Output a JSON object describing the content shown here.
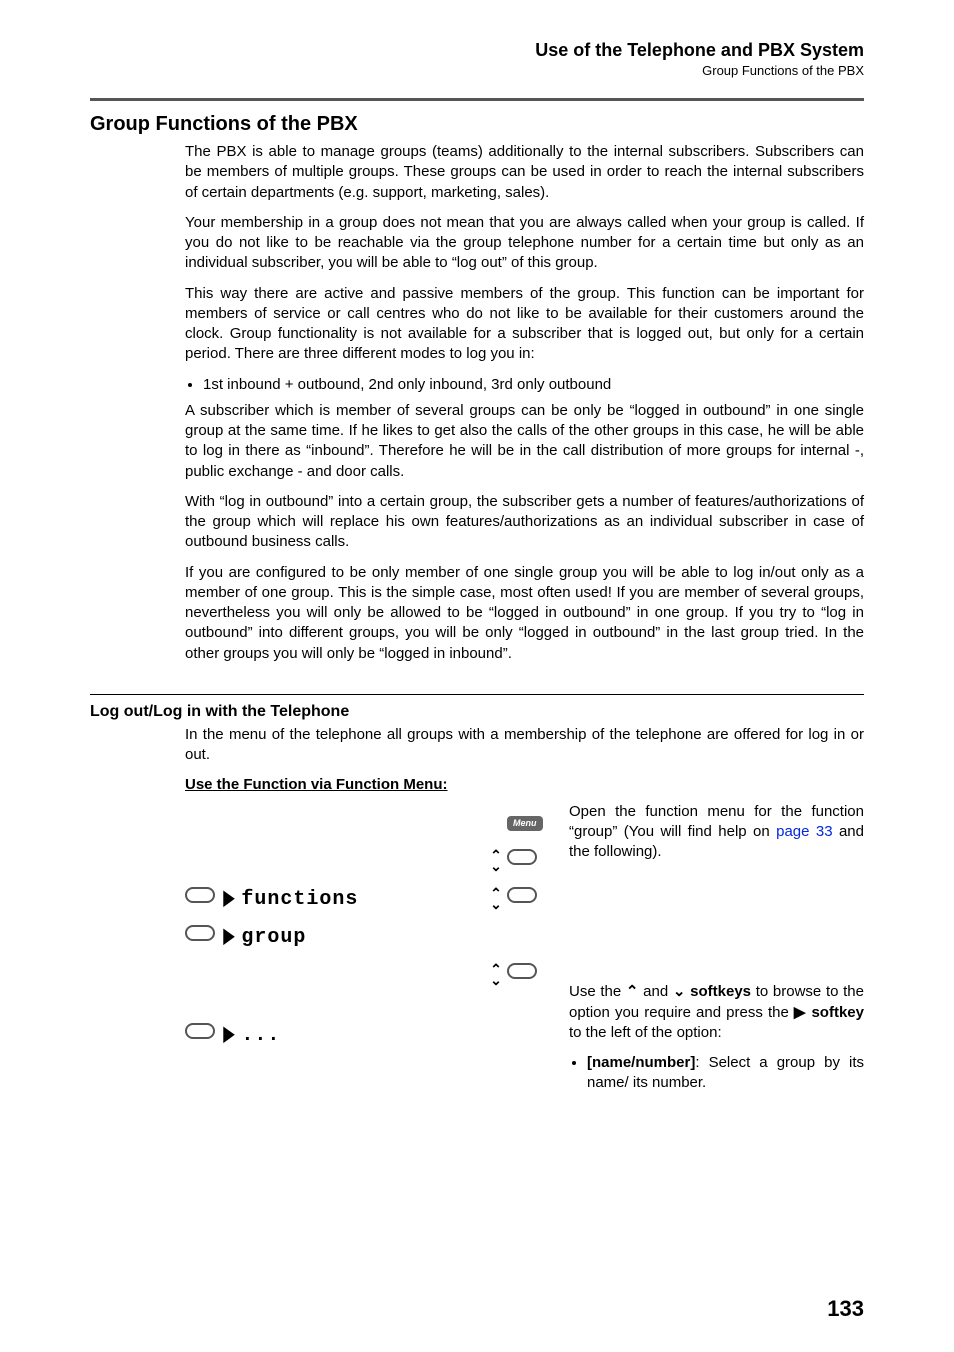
{
  "header": {
    "title": "Use of the Telephone and PBX System",
    "subtitle": "Group Functions of the PBX"
  },
  "section": {
    "heading": "Group Functions of the PBX",
    "paragraphs": [
      "The PBX is able to manage groups (teams) additionally to the internal subscribers. Subscribers can be members of multiple groups. These groups can be used in order to reach the internal subscribers of certain departments (e.g. support, marketing, sales).",
      "Your membership in a group does not mean that you are always called when your group is called. If you do not like to be reachable via the group telephone number for a certain time but only as an individual subscriber, you will be able to “log out” of this group.",
      "This way there are active and passive members of the group. This function can be important for members of service or call centres who do not like to be available for their customers around the clock. Group functionality is not available for a subscriber that is logged out, but only for a certain period. There are three different modes to log you in:"
    ],
    "bullet1": "1st inbound + outbound, 2nd only inbound, 3rd only outbound",
    "paragraphs2": [
      "A subscriber which is member of several groups can be only be “logged in outbound” in one single group at the same time. If he likes to get also the calls of the other groups in this case, he will be able to log in there as “inbound”. Therefore he will be in the call distribution of more groups for internal -, public exchange - and door calls.",
      "With “log in outbound” into a certain group, the subscriber gets a number of features/authorizations of the group which will replace his own features/authorizations as an individual subscriber in case of outbound business calls.",
      "If you are configured to be only member of one single group you will be able to log in/out only as a member of one group. This is the simple case, most often used! If you are member of several groups, nevertheless you will only be allowed to be “logged in outbound” in one group. If you try to “log in outbound” into different groups, you will be only “logged in outbound” in the last group tried. In the other groups you will only be “logged in inbound”."
    ]
  },
  "subsection": {
    "heading": "Log out/Log in with the Telephone",
    "intro": "In the menu of the telephone all groups with a membership of the telephone are offered for log in or out.",
    "func_heading": "Use the Function via Function Menu:"
  },
  "lcd": {
    "menu_label": "Menu",
    "row_functions": "functions",
    "row_group": "group",
    "row_dots": "..."
  },
  "rightcol": {
    "p1_a": "Open the function menu for the function “group” (You will find help on ",
    "p1_link": "page 33",
    "p1_b": " and the following).",
    "p2_a": "Use the ",
    "p2_b": " and ",
    "p2_c": " softkeys",
    "p2_d": " to browse to the option you require and press the ",
    "p2_e": " softkey",
    "p2_f": " to the left of the option:",
    "li_a": "[name/number]",
    "li_b": ": Select a group by its name/ its number."
  },
  "page_number": "133"
}
